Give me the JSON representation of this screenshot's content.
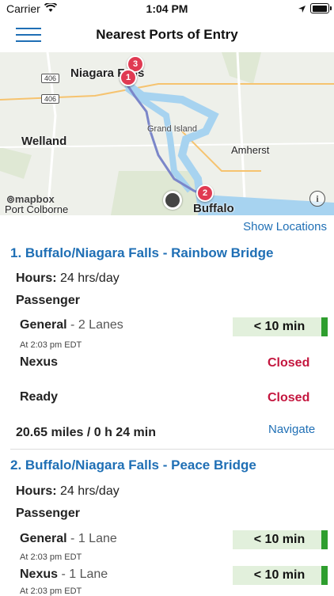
{
  "status_bar": {
    "carrier": "Carrier",
    "time": "1:04 PM"
  },
  "nav": {
    "title": "Nearest Ports of Entry"
  },
  "map": {
    "labels": {
      "niagara_falls": "Niagara Falls",
      "welland": "Welland",
      "grand_island": "Grand Island",
      "amherst": "Amherst",
      "port_colborne": "Port Colborne",
      "buffalo": "Buffalo",
      "hwy_406_top": "406",
      "hwy_406_bottom": "406"
    },
    "markers": [
      "1",
      "2",
      "3"
    ],
    "attribution": "mapbox",
    "info": "i"
  },
  "show_locations": "Show Locations",
  "ports": [
    {
      "title": "1. Buffalo/Niagara Falls - Rainbow Bridge",
      "hours_label": "Hours:",
      "hours_value": "24 hrs/day",
      "section": "Passenger",
      "general": {
        "name": "General",
        "lanes": "- 2 Lanes",
        "time": "At 2:03 pm EDT",
        "wait": "< 10 min"
      },
      "nexus": {
        "name": "Nexus",
        "status": "Closed"
      },
      "ready": {
        "name": "Ready",
        "status": "Closed"
      },
      "distance": "20.65 miles / 0 h 24 min",
      "navigate": "Navigate"
    },
    {
      "title": "2. Buffalo/Niagara Falls - Peace Bridge",
      "hours_label": "Hours:",
      "hours_value": "24 hrs/day",
      "section": "Passenger",
      "general": {
        "name": "General",
        "lanes": "- 1 Lane",
        "time": "At 2:03 pm EDT",
        "wait": "< 10 min"
      },
      "nexus": {
        "name": "Nexus",
        "lanes": "- 1 Lane",
        "time": "At 2:03 pm EDT",
        "wait": "< 10 min"
      }
    }
  ],
  "colors": {
    "accent": "#1f6fb5",
    "closed": "#c4173f",
    "wait_bg": "#e2f0dc",
    "wait_bar": "#2e9e2e",
    "marker": "#e03a52"
  }
}
